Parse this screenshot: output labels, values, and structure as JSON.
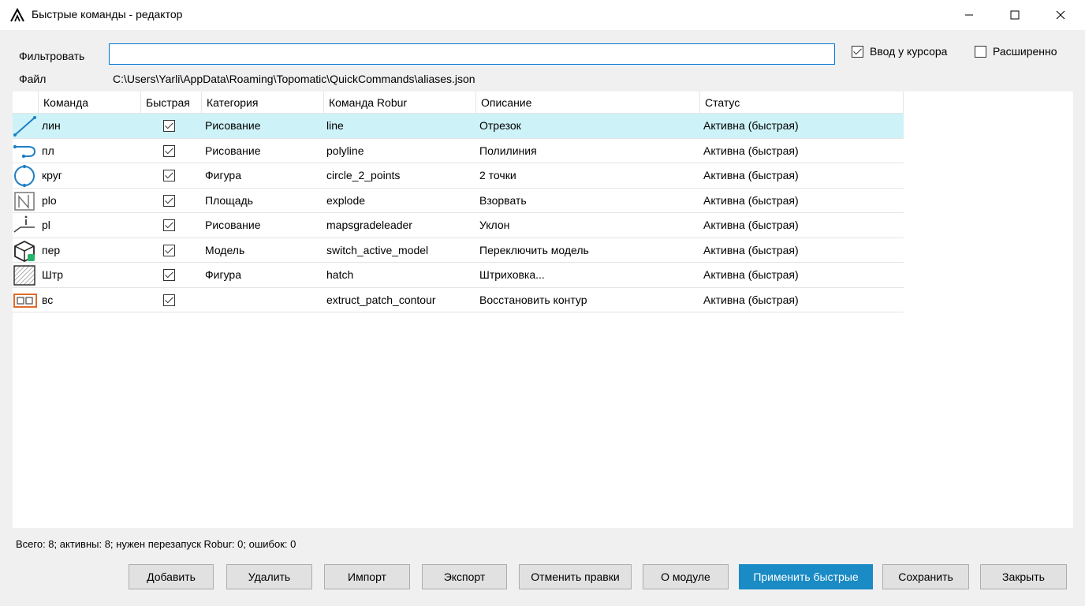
{
  "window": {
    "title": "Быстрые команды - редактор",
    "controls": [
      "minimize",
      "maximize",
      "close"
    ]
  },
  "filter": {
    "label": "Фильтровать",
    "value": "",
    "placeholder": ""
  },
  "options": {
    "cursor_input": {
      "label": "Ввод у курсора",
      "checked": true
    },
    "extended": {
      "label": "Расширенно",
      "checked": false
    }
  },
  "file": {
    "label": "Файл",
    "path": "C:\\Users\\Yarli\\AppData\\Roaming\\Topomatic\\QuickCommands\\aliases.json"
  },
  "table": {
    "columns": [
      "Команда",
      "Быстрая",
      "Категория",
      "Команда Robur",
      "Описание",
      "Статус"
    ],
    "rows": [
      {
        "icon": "line-icon",
        "command": "лин",
        "quick": true,
        "category": "Рисование",
        "robur": "line",
        "description": "Отрезок",
        "status": "Активна (быстрая)",
        "selected": true
      },
      {
        "icon": "polyline-icon",
        "command": "пл",
        "quick": true,
        "category": "Рисование",
        "robur": "polyline",
        "description": "Полилиния",
        "status": "Активна (быстрая)",
        "selected": false
      },
      {
        "icon": "circle-icon",
        "command": "круг",
        "quick": true,
        "category": "Фигура",
        "robur": "circle_2_points",
        "description": "2 точки",
        "status": "Активна (быстрая)",
        "selected": false
      },
      {
        "icon": "explode-icon",
        "command": "plo",
        "quick": true,
        "category": "Площадь",
        "robur": "explode",
        "description": "Взорвать",
        "status": "Активна (быстрая)",
        "selected": false
      },
      {
        "icon": "grade-leader-icon",
        "command": "pl",
        "quick": true,
        "category": "Рисование",
        "robur": "mapsgradeleader",
        "description": "Уклон",
        "status": "Активна (быстрая)",
        "selected": false
      },
      {
        "icon": "model-cube-icon",
        "command": "пер",
        "quick": true,
        "category": "Модель",
        "robur": "switch_active_model",
        "description": "Переключить модель",
        "status": "Активна (быстрая)",
        "selected": false
      },
      {
        "icon": "hatch-icon",
        "command": "Штр",
        "quick": true,
        "category": "Фигура",
        "robur": "hatch",
        "description": "Штриховка...",
        "status": "Активна (быстрая)",
        "selected": false
      },
      {
        "icon": "patch-contour-icon",
        "command": "вс",
        "quick": true,
        "category": "",
        "robur": "extruct_patch_contour",
        "description": "Восстановить контур",
        "status": "Активна (быстрая)",
        "selected": false
      }
    ]
  },
  "status_bar": {
    "text": "Всего: 8; активны: 8; нужен перезапуск Robur: 0; ошибок: 0"
  },
  "buttons": {
    "add": "Добавить",
    "delete": "Удалить",
    "import": "Импорт",
    "export": "Экспорт",
    "undo": "Отменить правки",
    "about": "О модуле",
    "apply": "Применить быстрые",
    "save": "Сохранить",
    "close": "Закрыть"
  },
  "colors": {
    "selected_row": "#cdf2f7",
    "primary_button": "#1a8bc4",
    "focus_border": "#0078d7",
    "icon_blue": "#1f7fc4"
  }
}
